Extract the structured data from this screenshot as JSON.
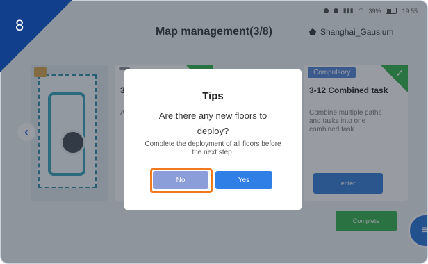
{
  "step_badge": "8",
  "status_bar": {
    "time": "19:55",
    "battery": "39%"
  },
  "header": {
    "title": "Map management(3/8)",
    "location": "Shanghai_Gausium"
  },
  "cards": {
    "left": {
      "tag": "",
      "title": "3",
      "desc": "A c"
    },
    "right": {
      "tag": "Compulsory",
      "title": "3-12  Combined task",
      "desc": "Combine multiple paths and tasks into one combined task",
      "enter_label": "enter"
    }
  },
  "complete_label": "Complete",
  "dialog": {
    "title": "Tips",
    "question": "Are there any new floors to deploy?",
    "note": "Complete the deployment of all floors before the next step.",
    "no_label": "No",
    "yes_label": "Yes"
  },
  "colors": {
    "accent": "#2f7fe6",
    "highlight": "#f07a20",
    "complete": "#2cae47",
    "corner": "#113f8c"
  }
}
